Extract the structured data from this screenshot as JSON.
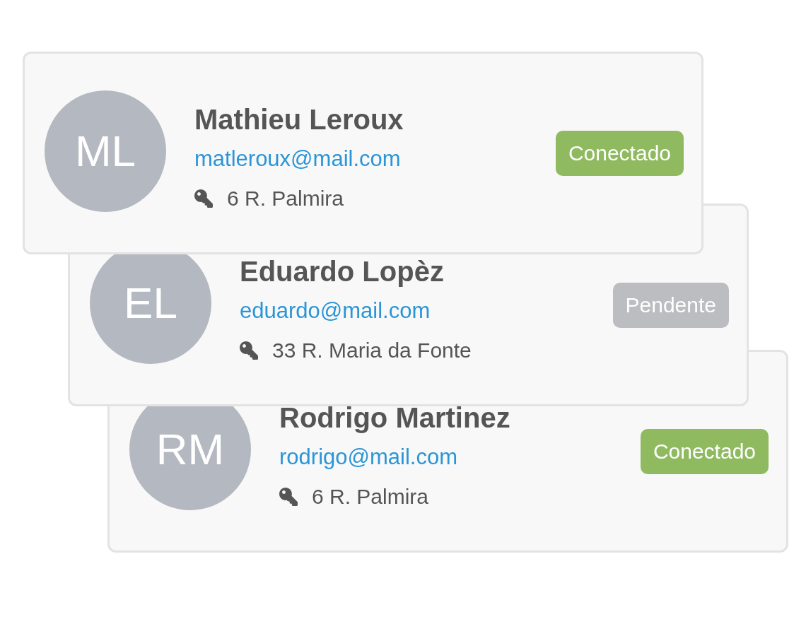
{
  "contacts": [
    {
      "initials": "ML",
      "name": "Mathieu Leroux",
      "email": "matleroux@mail.com",
      "address": "6 R. Palmira",
      "status": {
        "label": "Conectado",
        "kind": "connected"
      }
    },
    {
      "initials": "EL",
      "name": "Eduardo Lopèz",
      "email": "eduardo@mail.com",
      "address": "33 R. Maria da Fonte",
      "status": {
        "label": "Pendente",
        "kind": "pending"
      }
    },
    {
      "initials": "RM",
      "name": "Rodrigo Martinez",
      "email": "rodrigo@mail.com",
      "address": "6 R. Palmira",
      "status": {
        "label": "Conectado",
        "kind": "connected"
      }
    }
  ]
}
